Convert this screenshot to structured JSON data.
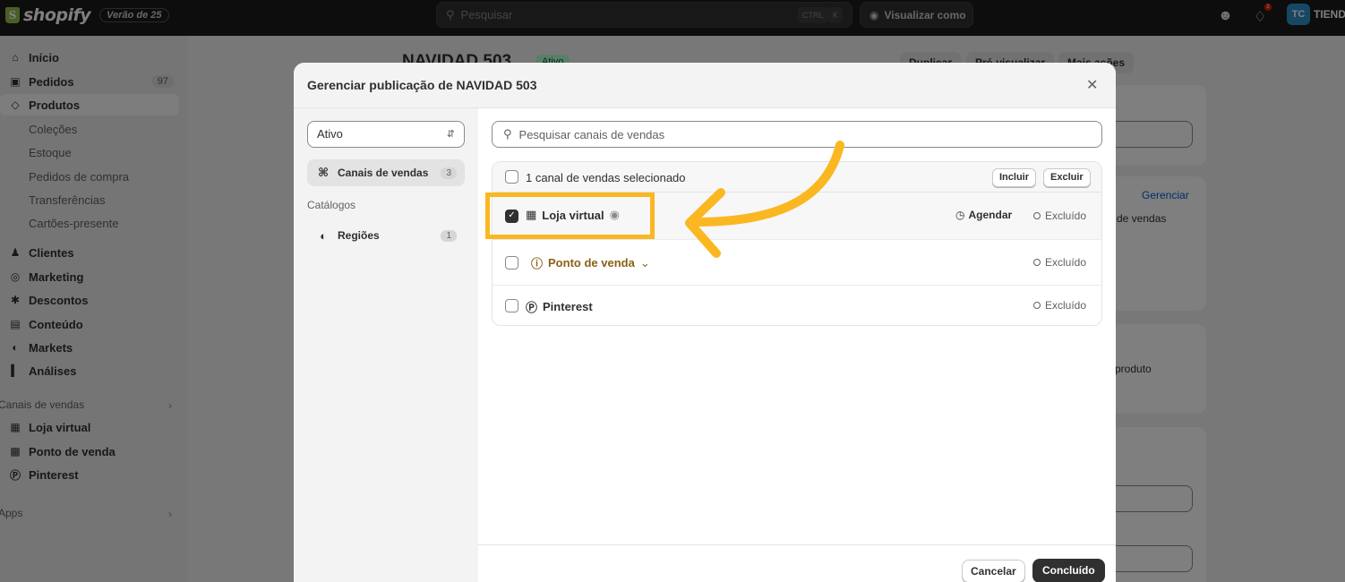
{
  "topbar": {
    "logo_text": "shopify",
    "logo_letter": "S",
    "edition": "Verão de 25",
    "search_placeholder": "Pesquisar",
    "shortcut_key1": "CTRL",
    "shortcut_key2": "K",
    "view_as": "Visualizar como",
    "notification_count": "2",
    "avatar_initials": "TC",
    "store_name": "TIEND"
  },
  "sidebar": {
    "items": [
      {
        "label": "Início",
        "icon": "home-icon"
      },
      {
        "label": "Pedidos",
        "icon": "orders-icon",
        "count": "97"
      },
      {
        "label": "Produtos",
        "icon": "tag-icon"
      }
    ],
    "product_subitems": [
      "Coleções",
      "Estoque",
      "Pedidos de compra",
      "Transferências",
      "Cartões-presente"
    ],
    "items2": [
      {
        "label": "Clientes",
        "icon": "person-icon"
      },
      {
        "label": "Marketing",
        "icon": "target-icon"
      },
      {
        "label": "Descontos",
        "icon": "discount-icon"
      },
      {
        "label": "Conteúdo",
        "icon": "content-icon"
      },
      {
        "label": "Markets",
        "icon": "globe-icon"
      },
      {
        "label": "Análises",
        "icon": "chart-icon"
      }
    ],
    "channels_section": "Canais de vendas",
    "channels": [
      {
        "label": "Loja virtual",
        "icon": "store-icon"
      },
      {
        "label": "Ponto de venda",
        "icon": "pos-icon"
      },
      {
        "label": "Pinterest",
        "icon": "pinterest-icon"
      }
    ],
    "apps_section": "Apps"
  },
  "background": {
    "title": "NAVIDAD 503",
    "badge": "Ativo",
    "duplicate": "Duplicar",
    "preview": "Pré-visualizar",
    "more_actions": "Mais ações",
    "manage_link": "Gerenciar",
    "text_sales": "de vendas",
    "text_product": "produto"
  },
  "modal": {
    "title": "Gerenciar publicação de NAVIDAD 503",
    "status_value": "Ativo",
    "left_items": [
      {
        "label": "Canais de vendas",
        "count": "3"
      },
      {
        "label": "Regiões",
        "count": "1"
      }
    ],
    "catalogs_label": "Catálogos",
    "search_placeholder": "Pesquisar canais de vendas",
    "selected_text": "1 canal de vendas selecionado",
    "include_btn": "Incluir",
    "exclude_btn": "Excluir",
    "schedule": "Agendar",
    "channels": [
      {
        "name": "Loja virtual",
        "status": "Excluído",
        "checked": true
      },
      {
        "name": "Ponto de venda",
        "status": "Excluído",
        "checked": false
      },
      {
        "name": "Pinterest",
        "status": "Excluído",
        "checked": false
      }
    ],
    "cancel": "Cancelar",
    "done": "Concluído"
  },
  "colors": {
    "highlight": "#fbb722",
    "warning_text": "#8a6116"
  }
}
